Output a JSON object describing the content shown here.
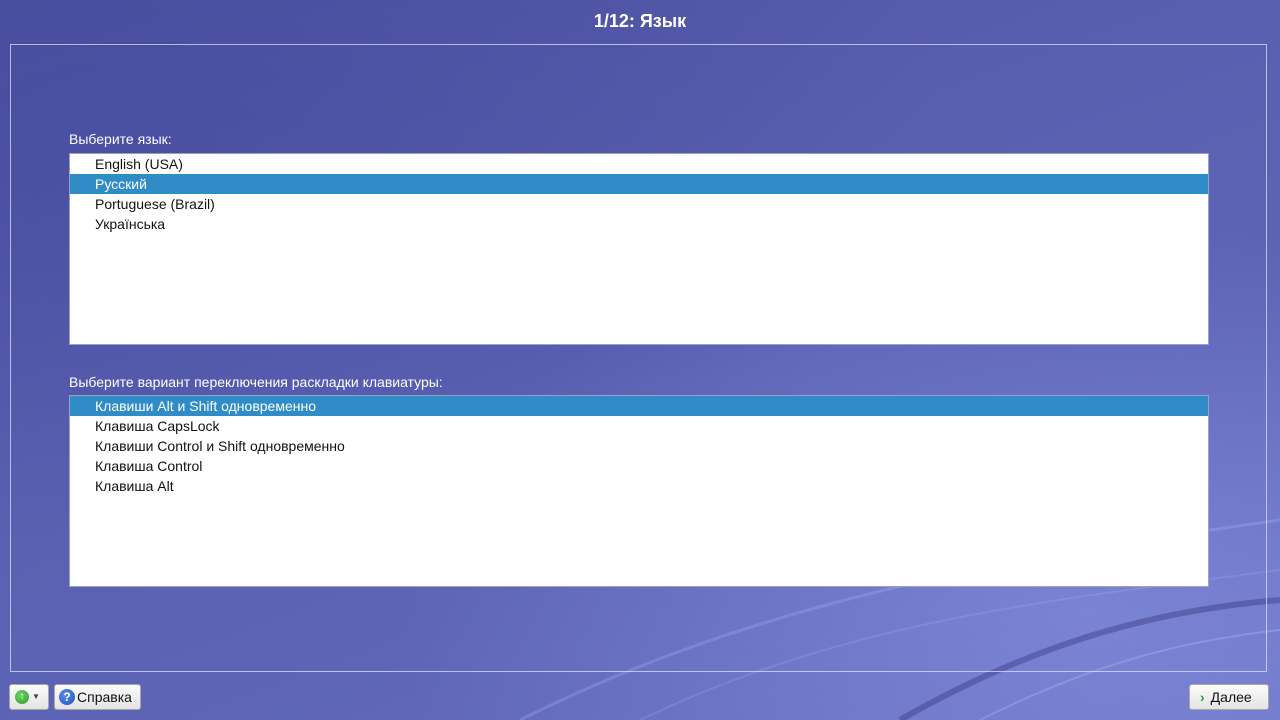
{
  "window": {
    "title": "1/12: Язык"
  },
  "language": {
    "label": "Выберите язык:",
    "items": [
      {
        "label": "English (USA)",
        "selected": false
      },
      {
        "label": "Русский",
        "selected": true
      },
      {
        "label": "Portuguese (Brazil)",
        "selected": false
      },
      {
        "label": "Українська",
        "selected": false
      }
    ]
  },
  "keyboard": {
    "label": "Выберите вариант переключения раскладки клавиатуры:",
    "items": [
      {
        "label": "Клавиши Alt и Shift одновременно",
        "selected": true
      },
      {
        "label": "Клавиша CapsLock",
        "selected": false
      },
      {
        "label": "Клавиши Control и Shift одновременно",
        "selected": false
      },
      {
        "label": "Клавиша Control",
        "selected": false
      },
      {
        "label": "Клавиша Alt",
        "selected": false
      }
    ]
  },
  "footer": {
    "help_label": "Справка",
    "next_label": "Далее"
  },
  "icons": {
    "menu": "up-arrow-icon",
    "help": "help-icon",
    "next": "chevron-right-icon"
  },
  "colors": {
    "selection": "#308cc6",
    "list_background": "#ffffff",
    "title_text": "#ffffff"
  }
}
